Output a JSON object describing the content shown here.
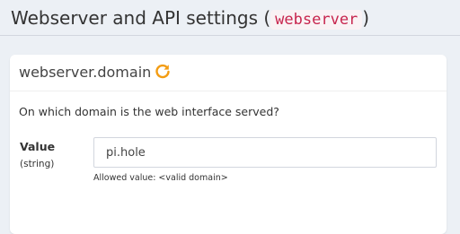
{
  "page": {
    "title_prefix": "Webserver and API settings (",
    "title_code": "webserver",
    "title_suffix": ")"
  },
  "setting": {
    "name": "webserver.domain",
    "icon": "refresh-icon",
    "icon_color": "#f39c12",
    "description": "On which domain is the web interface served?",
    "value_label": "Value",
    "value_type": "(string)",
    "value": "pi.hole",
    "hint": "Allowed value: <valid domain>"
  }
}
